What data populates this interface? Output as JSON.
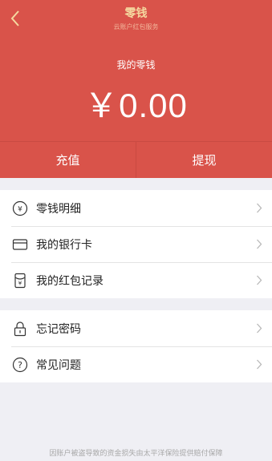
{
  "header": {
    "title": "零钱",
    "subtitle": "云账户红包服务",
    "wallet_label": "我的零钱",
    "balance": "￥0.00",
    "bg_color": "#d9534a"
  },
  "actions": {
    "recharge": "充值",
    "withdraw": "提现"
  },
  "menu": {
    "group1": [
      {
        "label": "零钱明细",
        "icon": "yen-circle-icon"
      },
      {
        "label": "我的银行卡",
        "icon": "bank-card-icon"
      },
      {
        "label": "我的红包记录",
        "icon": "red-packet-icon"
      }
    ],
    "group2": [
      {
        "label": "忘记密码",
        "icon": "lock-icon"
      },
      {
        "label": "常见问题",
        "icon": "question-circle-icon"
      }
    ]
  },
  "footer": {
    "note": "因账户被盗导致的资金损失由太平洋保险提供赔付保障"
  }
}
